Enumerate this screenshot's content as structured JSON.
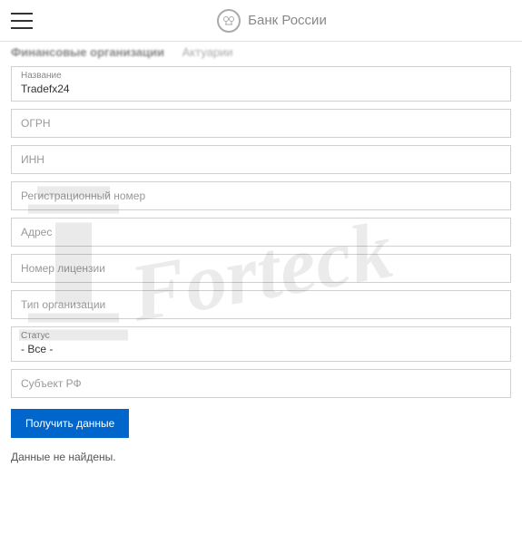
{
  "header": {
    "brand": "Банк России"
  },
  "breadcrumb": {
    "primary": "Финансовые организации",
    "secondary": "Актуарии"
  },
  "form": {
    "name_label": "Название",
    "name_value": "Tradefx24",
    "ogrn_placeholder": "ОГРН",
    "inn_placeholder": "ИНН",
    "reg_number_placeholder": "Регистрационный номер",
    "address_placeholder": "Адрес",
    "license_placeholder": "Номер лицензии",
    "org_type_placeholder": "Тип организации",
    "status_label": "Статус",
    "status_value": "- Все -",
    "subject_placeholder": "Субъект РФ",
    "submit_label": "Получить данные"
  },
  "result": {
    "not_found": "Данные не найдены."
  },
  "watermark": {
    "text": "Forteck"
  }
}
